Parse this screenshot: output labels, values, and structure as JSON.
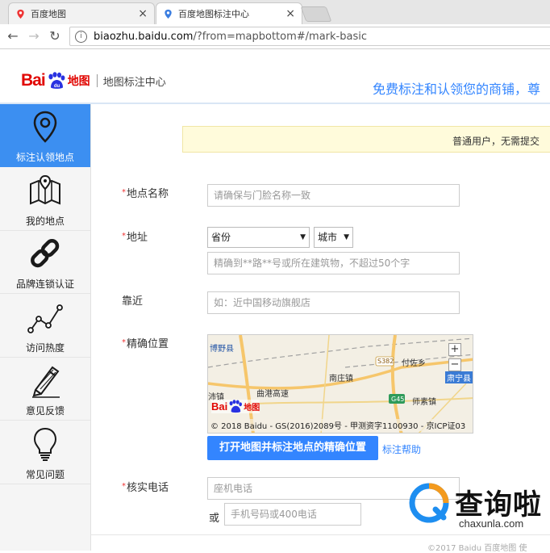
{
  "browser": {
    "tabs": [
      {
        "label": "百度地图",
        "active": false
      },
      {
        "label": "百度地图标注中心",
        "active": true
      }
    ],
    "url_host": "biaozhu.baidu.com",
    "url_path": "/?from=mapbottom#/mark-basic"
  },
  "header": {
    "logo_bai": "Bai",
    "logo_map": "地图",
    "logo_sub": "地图标注中心",
    "slogan": "免费标注和认领您的商铺，尊"
  },
  "sidebar": {
    "items": [
      {
        "label": "标注认领地点",
        "icon": "location-pin-icon",
        "active": true
      },
      {
        "label": "我的地点",
        "icon": "folded-map-icon",
        "active": false
      },
      {
        "label": "品牌连锁认证",
        "icon": "chain-link-icon",
        "active": false
      },
      {
        "label": "访问热度",
        "icon": "line-trend-icon",
        "active": false
      },
      {
        "label": "意见反馈",
        "icon": "pencil-icon",
        "active": false
      },
      {
        "label": "常见问题",
        "icon": "lightbulb-icon",
        "active": false
      }
    ]
  },
  "notice": "普通用户，无需提交",
  "form": {
    "name_label": "地点名称",
    "name_placeholder": "请确保与门脸名称一致",
    "address_label": "地址",
    "province": "省份",
    "city": "城市",
    "address_placeholder": "精确到**路**号或所在建筑物，不超过50个字",
    "near_label": "靠近",
    "near_placeholder": "如：近中国移动旗舰店",
    "location_label": "精确位置",
    "open_map_button": "打开地图并标注地点的精确位置",
    "help_link": "标注帮助",
    "phone_label": "核实电话",
    "landline_placeholder": "座机电话",
    "or_text": "或",
    "mobile_placeholder": "手机号码或400电话"
  },
  "map": {
    "labels": [
      "博野县",
      "付佐乡",
      "南庄镇",
      "肃宁县",
      "曲港高速",
      "师素镇",
      "沛镇"
    ],
    "road_badges": [
      "S382",
      "G45"
    ],
    "zoom_in": "+",
    "zoom_out": "−",
    "copyright": "© 2018 Baidu - GS(2016)2089号 - 甲测资字1100930 - 京ICP证03",
    "logo_bai": "Bai",
    "logo_map": "地图"
  },
  "footer": "©2017 Baidu  百度地图  使",
  "watermark": {
    "cn": "查询啦",
    "en": "chaxunla.com"
  },
  "colors": {
    "accent": "#3385ff",
    "sidebar_active": "#3c8ff1",
    "baidu_red": "#e10602",
    "notice_bg": "#fffbdb"
  }
}
